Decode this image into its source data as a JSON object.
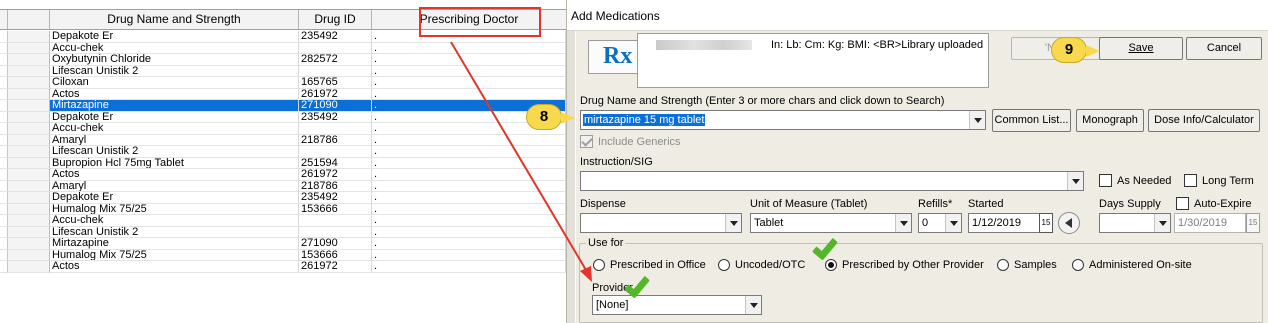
{
  "grid": {
    "headers": {
      "drug_name": "Drug Name and Strength",
      "drug_id": "Drug ID",
      "prescribing_doctor": "Prescribing Doctor"
    },
    "rows": [
      {
        "name": "Depakote Er",
        "id": "235492",
        "doctor": "."
      },
      {
        "name": "Accu-chek",
        "id": "",
        "doctor": "."
      },
      {
        "name": "Oxybutynin Chloride",
        "id": "282572",
        "doctor": "."
      },
      {
        "name": "Lifescan Unistik 2",
        "id": "",
        "doctor": "."
      },
      {
        "name": "Ciloxan",
        "id": "165765",
        "doctor": "."
      },
      {
        "name": "Actos",
        "id": "261972",
        "doctor": "."
      },
      {
        "name": "Mirtazapine",
        "id": "271090",
        "doctor": ".",
        "selected": true
      },
      {
        "name": "Depakote Er",
        "id": "235492",
        "doctor": "."
      },
      {
        "name": "Accu-chek",
        "id": "",
        "doctor": "."
      },
      {
        "name": "Amaryl",
        "id": "218786",
        "doctor": "."
      },
      {
        "name": "Lifescan Unistik 2",
        "id": "",
        "doctor": "."
      },
      {
        "name": "Bupropion Hcl 75mg Tablet",
        "id": "251594",
        "doctor": "."
      },
      {
        "name": "Actos",
        "id": "261972",
        "doctor": "."
      },
      {
        "name": "Amaryl",
        "id": "218786",
        "doctor": "."
      },
      {
        "name": "Depakote Er",
        "id": "235492",
        "doctor": "."
      },
      {
        "name": "Humalog Mix 75/25",
        "id": "153666",
        "doctor": "."
      },
      {
        "name": "Accu-chek",
        "id": "",
        "doctor": "."
      },
      {
        "name": "Lifescan Unistik 2",
        "id": "",
        "doctor": "."
      },
      {
        "name": "Mirtazapine",
        "id": "271090",
        "doctor": "."
      },
      {
        "name": "Humalog Mix 75/25",
        "id": "153666",
        "doctor": "."
      },
      {
        "name": "Actos",
        "id": "261972",
        "doctor": "."
      }
    ]
  },
  "dialog": {
    "title": "Add Medications",
    "rx_icon": "Rx",
    "patient_stats": "In:  Lb:  Cm:  Kg:  BMI:  <BR>Library uploaded",
    "buttons": {
      "not_available": "'No I",
      "save": "Save",
      "cancel": "Cancel",
      "common_list": "Common List...",
      "monograph": "Monograph",
      "dose_info": "Dose Info/Calculator"
    },
    "drug_label": "Drug Name and Strength (Enter 3 or more chars and click down to Search)",
    "drug_value": "mirtazapine 15 mg tablet",
    "include_generics": "Include Generics",
    "instruction_label": "Instruction/SIG",
    "instruction_value": "",
    "as_needed": "As Needed",
    "long_term": "Long Term",
    "dispense_label": "Dispense",
    "dispense_value": "",
    "uom_label": "Unit of Measure (Tablet)",
    "uom_value": "Tablet",
    "refills_label": "Refills*",
    "refills_value": "0",
    "started_label": "Started",
    "started_value": "1/12/2019",
    "days_supply_label": "Days Supply",
    "days_supply_value": "",
    "auto_expire": "Auto-Expire",
    "auto_expire_value": "1/30/2019",
    "use_for_label": "Use for",
    "use_for_options": [
      "Prescribed in Office",
      "Uncoded/OTC",
      "Prescribed by Other Provider",
      "Samples",
      "Administered On-site"
    ],
    "provider_label": "Provider",
    "provider_value": "[None]",
    "calendar_icon": "15"
  },
  "annotations": {
    "badge_8": "8",
    "badge_9": "9",
    "colors": {
      "highlight": "#e2352b",
      "badge": "#f8d94e",
      "check": "#55b62c",
      "selection": "#0a6fd6"
    }
  }
}
